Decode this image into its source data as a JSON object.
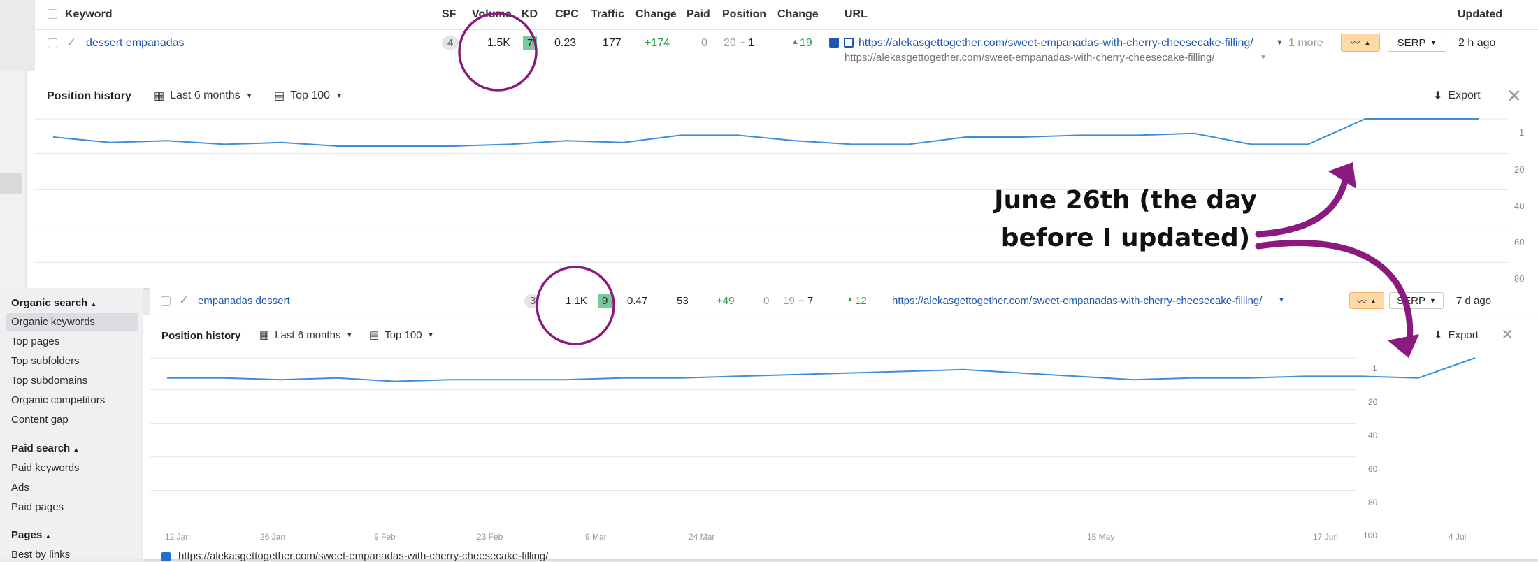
{
  "table": {
    "headers": {
      "keyword": "Keyword",
      "sf": "SF",
      "volume": "Volume",
      "kd": "KD",
      "cpc": "CPC",
      "traffic": "Traffic",
      "change": "Change",
      "paid": "Paid",
      "position": "Position",
      "change2": "Change",
      "url": "URL",
      "updated": "Updated"
    },
    "row1": {
      "keyword": "dessert empanadas",
      "sf": "4",
      "volume": "1.5K",
      "kd": "7",
      "cpc": "0.23",
      "traffic": "177",
      "traffic_change": "+174",
      "paid": "0",
      "pos_from": "20",
      "pos_to": "1",
      "pos_change": "19",
      "url": "https://alekasgettogether.com/sweet-empanadas-with-cherry-cheesecake-filling/",
      "more": "1 more",
      "url2": "https://alekasgettogether.com/sweet-empanadas-with-cherry-cheesecake-filling/",
      "serp": "SERP",
      "updated": "2 h ago"
    }
  },
  "panel1": {
    "title": "Position history",
    "range": "Last 6 months",
    "top": "Top 100",
    "export": "Export",
    "y_labels": [
      "1",
      "20",
      "40",
      "60",
      "80"
    ]
  },
  "row2": {
    "keyword": "empanadas dessert",
    "sf": "3",
    "volume": "1.1K",
    "kd": "9",
    "cpc": "0.47",
    "traffic": "53",
    "traffic_change": "+49",
    "paid": "0",
    "pos_from": "19",
    "pos_to": "7",
    "pos_change": "12",
    "url": "https://alekasgettogether.com/sweet-empanadas-with-cherry-cheesecake-filling/",
    "serp": "SERP",
    "updated": "7 d ago"
  },
  "panel2": {
    "title": "Position history",
    "range": "Last 6 months",
    "top": "Top 100",
    "export": "Export",
    "y_labels": [
      "1",
      "20",
      "40",
      "60",
      "80",
      "100"
    ],
    "x_labels": [
      "12 Jan",
      "26 Jan",
      "9 Feb",
      "23 Feb",
      "9 Mar",
      "24 Mar",
      "15 May",
      "17 Jun",
      "4 Jul"
    ],
    "legend_url": "https://alekasgettogether.com/sweet-empanadas-with-cherry-cheesecake-filling/"
  },
  "sidebar": {
    "organic_head": "Organic search",
    "organic": [
      "Organic keywords",
      "Top pages",
      "Top subfolders",
      "Top subdomains",
      "Organic competitors",
      "Content gap"
    ],
    "paid_head": "Paid search",
    "paid": [
      "Paid keywords",
      "Ads",
      "Paid pages"
    ],
    "pages_head": "Pages",
    "pages": [
      "Best by links"
    ]
  },
  "annotation": {
    "line1": "June 26th (the day",
    "line2": "before I updated)"
  },
  "colors": {
    "line": "#3a8ee0",
    "accent": "#8b1a7e",
    "kd": "#7bc99a",
    "positive": "#27a046"
  },
  "chart_data": [
    {
      "type": "line",
      "y_inverted": true,
      "ylim": [
        1,
        100
      ],
      "y_ticks": [
        1,
        20,
        40,
        60,
        80
      ],
      "series": [
        {
          "values": [
            11,
            14,
            13,
            15,
            14,
            16,
            16,
            16,
            15,
            13,
            14,
            10,
            10,
            13,
            15,
            15,
            11,
            11,
            10,
            10,
            9,
            15,
            15,
            1,
            1,
            1
          ]
        }
      ]
    },
    {
      "type": "line",
      "y_inverted": true,
      "ylim": [
        1,
        100
      ],
      "y_ticks": [
        1,
        20,
        40,
        60,
        80,
        100
      ],
      "x_ticks": [
        "12 Jan",
        "26 Jan",
        "9 Feb",
        "23 Feb",
        "9 Mar",
        "24 Mar",
        "15 May",
        "17 Jun",
        "4 Jul"
      ],
      "series": [
        {
          "values": [
            13,
            13,
            14,
            13,
            15,
            14,
            14,
            14,
            13,
            13,
            12,
            11,
            10,
            9,
            8,
            10,
            12,
            14,
            13,
            13,
            12,
            12,
            13,
            1
          ]
        }
      ]
    }
  ]
}
